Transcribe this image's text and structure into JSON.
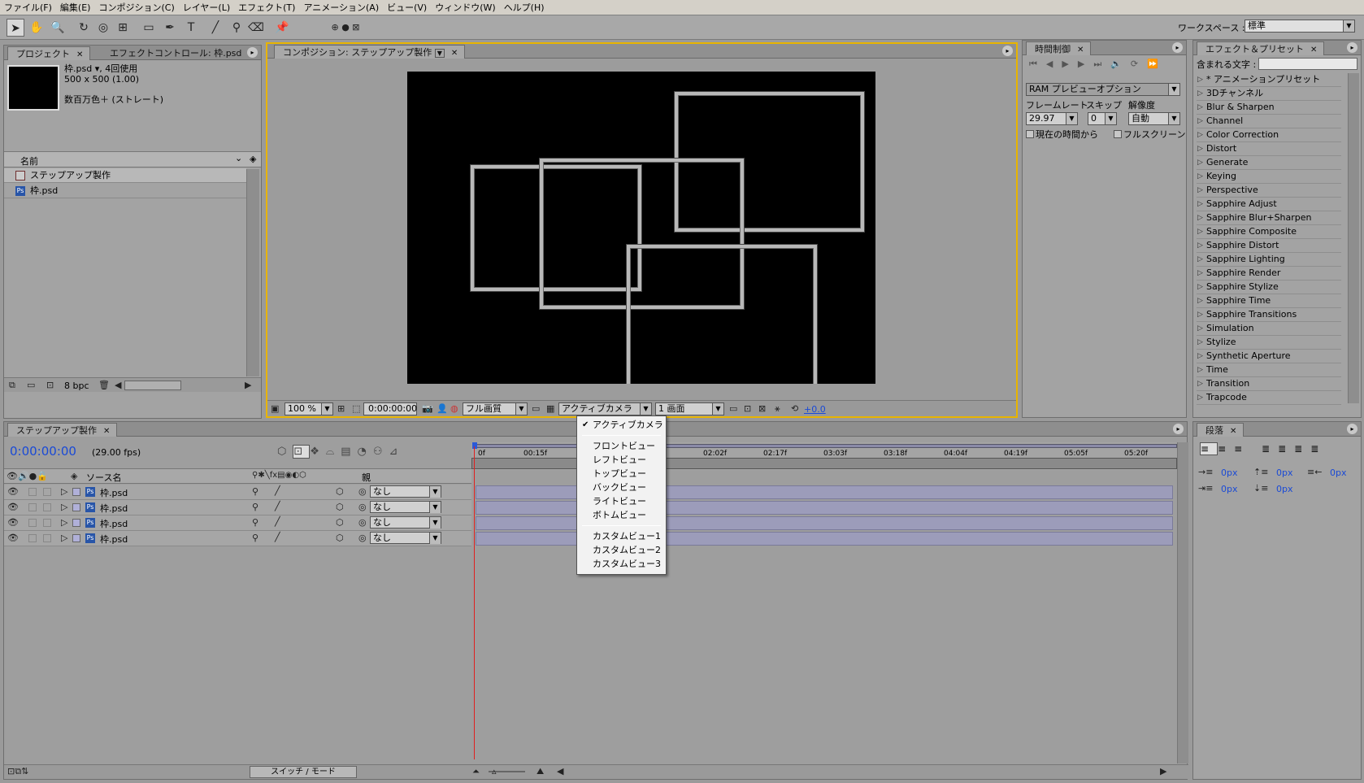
{
  "menubar": [
    "ファイル(F)",
    "編集(E)",
    "コンポジション(C)",
    "レイヤー(L)",
    "エフェクト(T)",
    "アニメーション(A)",
    "ビュー(V)",
    "ウィンドウ(W)",
    "ヘルプ(H)"
  ],
  "workspace": {
    "label": "ワークスペース :",
    "value": "標準"
  },
  "project": {
    "tab": "プロジェクト",
    "tab2": "エフェクトコントロール: 枠.psd",
    "file_name": "枠.psd ▾, 4回使用",
    "dimensions": "500 x 500 (1.00)",
    "color_info": "数百万色＋ (ストレート)",
    "col_name": "名前",
    "items": [
      "ステップアップ製作",
      "枠.psd"
    ],
    "bpc": "8 bpc"
  },
  "comp": {
    "tab": "コンポジション: ステップアップ製作",
    "zoom": "100 %",
    "timecode": "0:00:00:00",
    "quality": "フル画質",
    "camera": "アクティブカメラ",
    "views": "1 画面",
    "exposure": "+0.0"
  },
  "time_control": {
    "tab": "時間制御",
    "ram_option": "RAM プレビューオプション",
    "framerate_label": "フレームレート",
    "skip_label": "スキップ",
    "res_label": "解像度",
    "framerate": "29.97",
    "skip": "0",
    "res": "自動",
    "from_current": "現在の時間から",
    "fullscreen": "フルスクリーン"
  },
  "effects": {
    "tab": "エフェクト＆プリセット",
    "search_label": "含まれる文字 :",
    "items": [
      "* アニメーションプリセット",
      "3Dチャンネル",
      "Blur & Sharpen",
      "Channel",
      "Color Correction",
      "Distort",
      "Generate",
      "Keying",
      "Perspective",
      "Sapphire Adjust",
      "Sapphire Blur+Sharpen",
      "Sapphire Composite",
      "Sapphire Distort",
      "Sapphire Lighting",
      "Sapphire Render",
      "Sapphire Stylize",
      "Sapphire Time",
      "Sapphire Transitions",
      "Simulation",
      "Stylize",
      "Synthetic Aperture",
      "Time",
      "Transition",
      "Trapcode"
    ]
  },
  "timeline": {
    "tab": "ステップアップ製作",
    "timecode": "0:00:00:00",
    "fps": "(29.00 fps)",
    "source_name": "ソース名",
    "parent": "親",
    "layers": [
      {
        "name": "枠.psd",
        "parent": "なし"
      },
      {
        "name": "枠.psd",
        "parent": "なし"
      },
      {
        "name": "枠.psd",
        "parent": "なし"
      },
      {
        "name": "枠.psd",
        "parent": "なし"
      }
    ],
    "ruler": [
      "0f",
      "00:15f",
      "02:02f",
      "02:17f",
      "03:03f",
      "03:18f",
      "04:04f",
      "04:19f",
      "05:05f",
      "05:20f"
    ],
    "switch_mode": "スイッチ / モード"
  },
  "paragraph": {
    "tab": "段落",
    "values": [
      "0px",
      "0px",
      "0px",
      "0px",
      "0px"
    ]
  },
  "camera_menu": {
    "checked": "アクティブカメラ",
    "group1": [
      "フロントビュー",
      "レフトビュー",
      "トップビュー",
      "バックビュー",
      "ライトビュー",
      "ボトムビュー"
    ],
    "group2": [
      "カスタムビュー1",
      "カスタムビュー2",
      "カスタムビュー3"
    ]
  },
  "colors": {
    "accent_border": "#e8b400",
    "timecode_blue": "#1a4ad6",
    "playhead": "#e02020",
    "layer_bar": "#9c9cba"
  }
}
